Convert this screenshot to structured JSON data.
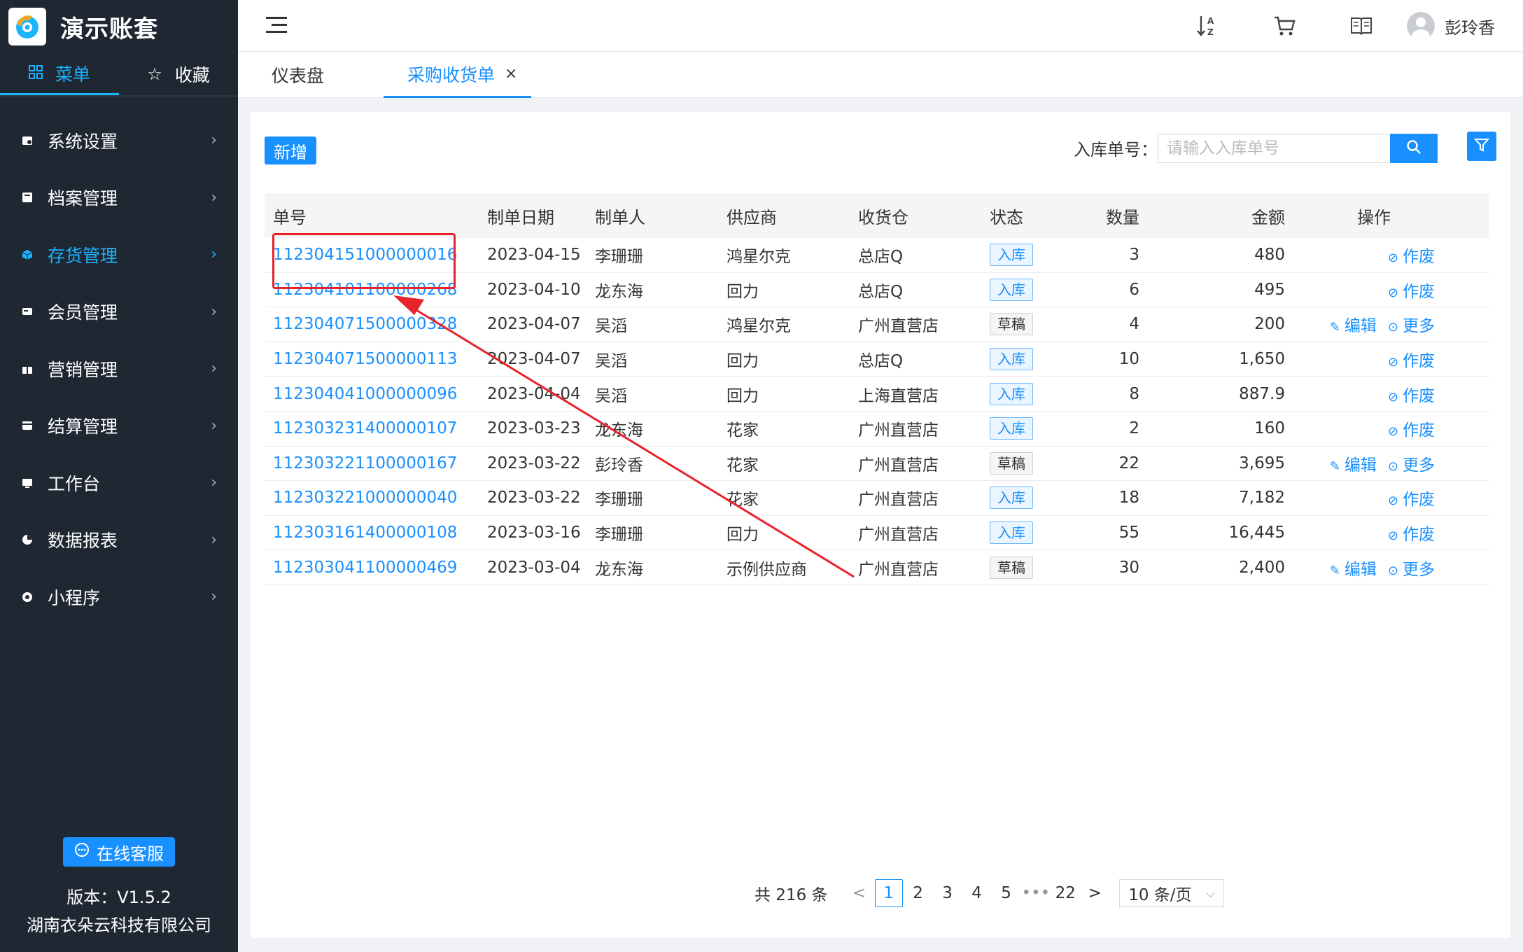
{
  "brand": {
    "title": "演示账套"
  },
  "sidebar": {
    "tabs": [
      {
        "label": "菜单",
        "icon": "grid-icon",
        "active": true
      },
      {
        "label": "收藏",
        "icon": "star-icon",
        "active": false
      }
    ],
    "items": [
      {
        "label": "系统设置",
        "icon": "settings-icon"
      },
      {
        "label": "档案管理",
        "icon": "archive-icon"
      },
      {
        "label": "存货管理",
        "icon": "cube-icon",
        "active": true
      },
      {
        "label": "会员管理",
        "icon": "member-card-icon"
      },
      {
        "label": "营销管理",
        "icon": "gift-icon"
      },
      {
        "label": "结算管理",
        "icon": "wallet-icon"
      },
      {
        "label": "工作台",
        "icon": "monitor-icon"
      },
      {
        "label": "数据报表",
        "icon": "pie-chart-icon"
      },
      {
        "label": "小程序",
        "icon": "mini-program-icon"
      }
    ],
    "service_label": "在线客服",
    "version": "版本：V1.5.2",
    "company": "湖南衣朵云科技有限公司"
  },
  "header": {
    "icons": [
      "sort-az-icon",
      "cart-icon",
      "book-icon"
    ],
    "user_name": "彭玲香"
  },
  "page_tabs": [
    {
      "label": "仪表盘",
      "active": false
    },
    {
      "label": "采购收货单",
      "active": true,
      "close": "×"
    }
  ],
  "toolbar": {
    "add_label": "新增",
    "search_label": "入库单号：",
    "search_placeholder": "请输入入库单号"
  },
  "table": {
    "columns": [
      "单号",
      "制单日期",
      "制单人",
      "供应商",
      "收货仓",
      "状态",
      "数量",
      "金额",
      "操作"
    ],
    "rows": [
      {
        "no": "112304151000000016",
        "date": "2023-04-15",
        "maker": "李珊珊",
        "supplier": "鸿星尔克",
        "warehouse": "总店Q",
        "status": "入库",
        "qty": "3",
        "amount": "480",
        "ops": [
          "作废"
        ]
      },
      {
        "no": "112304101100000268",
        "date": "2023-04-10",
        "maker": "龙东海",
        "supplier": "回力",
        "warehouse": "总店Q",
        "status": "入库",
        "qty": "6",
        "amount": "495",
        "ops": [
          "作废"
        ]
      },
      {
        "no": "112304071500000328",
        "date": "2023-04-07",
        "maker": "吴滔",
        "supplier": "鸿星尔克",
        "warehouse": "广州直营店",
        "status": "草稿",
        "qty": "4",
        "amount": "200",
        "ops": [
          "编辑",
          "更多"
        ]
      },
      {
        "no": "112304071500000113",
        "date": "2023-04-07",
        "maker": "吴滔",
        "supplier": "回力",
        "warehouse": "总店Q",
        "status": "入库",
        "qty": "10",
        "amount": "1,650",
        "ops": [
          "作废"
        ]
      },
      {
        "no": "112304041000000096",
        "date": "2023-04-04",
        "maker": "吴滔",
        "supplier": "回力",
        "warehouse": "上海直营店",
        "status": "入库",
        "qty": "8",
        "amount": "887.9",
        "ops": [
          "作废"
        ]
      },
      {
        "no": "112303231400000107",
        "date": "2023-03-23",
        "maker": "龙东海",
        "supplier": "花家",
        "warehouse": "广州直营店",
        "status": "入库",
        "qty": "2",
        "amount": "160",
        "ops": [
          "作废"
        ]
      },
      {
        "no": "112303221100000167",
        "date": "2023-03-22",
        "maker": "彭玲香",
        "supplier": "花家",
        "warehouse": "广州直营店",
        "status": "草稿",
        "qty": "22",
        "amount": "3,695",
        "ops": [
          "编辑",
          "更多"
        ]
      },
      {
        "no": "112303221000000040",
        "date": "2023-03-22",
        "maker": "李珊珊",
        "supplier": "花家",
        "warehouse": "广州直营店",
        "status": "入库",
        "qty": "18",
        "amount": "7,182",
        "ops": [
          "作废"
        ]
      },
      {
        "no": "112303161400000108",
        "date": "2023-03-16",
        "maker": "李珊珊",
        "supplier": "回力",
        "warehouse": "广州直营店",
        "status": "入库",
        "qty": "55",
        "amount": "16,445",
        "ops": [
          "作废"
        ]
      },
      {
        "no": "112303041100000469",
        "date": "2023-03-04",
        "maker": "龙东海",
        "supplier": "示例供应商",
        "warehouse": "广州直营店",
        "status": "草稿",
        "qty": "30",
        "amount": "2,400",
        "ops": [
          "编辑",
          "更多"
        ]
      }
    ]
  },
  "pagination": {
    "total": "共 216 条",
    "prev": "<",
    "pages": [
      "1",
      "2",
      "3",
      "4",
      "5",
      "•••",
      "22"
    ],
    "current": "1",
    "next": ">",
    "page_size": "10 条/页"
  },
  "colors": {
    "primary": "#1890ff",
    "sidebar_bg": "#1f2733",
    "sidebar_active": "#1ab4ff",
    "annotation": "#e8222a"
  }
}
